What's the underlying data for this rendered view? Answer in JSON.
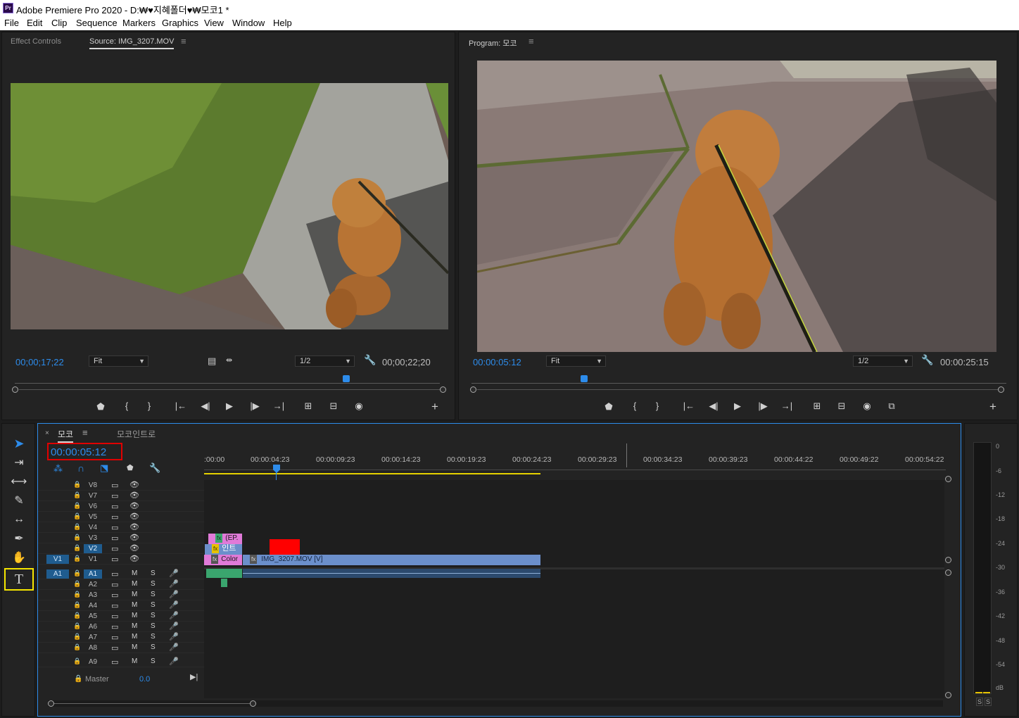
{
  "window": {
    "app_icon": "Pr",
    "title": "Adobe Premiere Pro 2020 - D:₩♥지혜폴더♥₩모코1 *"
  },
  "menu": [
    "File",
    "Edit",
    "Clip",
    "Sequence",
    "Markers",
    "Graphics",
    "View",
    "Window",
    "Help"
  ],
  "source_panel": {
    "tab_effect_controls": "Effect Controls",
    "tab_source": "Source: IMG_3207.MOV",
    "menu_icon": "≡",
    "timecode_current": "00;00;17;22",
    "zoom": "Fit",
    "resolution": "1/2",
    "timecode_duration": "00;00;22;20",
    "playhead_position": 0.78
  },
  "program_panel": {
    "tab_program": "Program: 모코",
    "menu_icon": "≡",
    "timecode_current": "00:00:05:12",
    "zoom": "Fit",
    "resolution": "1/2",
    "timecode_duration": "00:00:25:15",
    "playhead_position": 0.21
  },
  "timeline": {
    "tab_close": "×",
    "tab_active": "모코",
    "tab_menu": "≡",
    "tab_inactive": "모코인트로",
    "timecode": "00:00:05:12",
    "ruler_labels": [
      ":00:00",
      "00:00:04:23",
      "00:00:09:23",
      "00:00:14:23",
      "00:00:19:23",
      "00:00:24:23",
      "00:00:29:23",
      "00:00:34:23",
      "00:00:39:23",
      "00:00:44:22",
      "00:00:49:22",
      "00:00:54:22"
    ],
    "video_tracks": [
      "V8",
      "V7",
      "V6",
      "V5",
      "V4",
      "V3",
      "V2",
      "V1"
    ],
    "audio_tracks": [
      "A1",
      "A2",
      "A3",
      "A4",
      "A5",
      "A6",
      "A7",
      "A8",
      "A9"
    ],
    "source_patch_video": "V1",
    "source_patch_audio": "A1",
    "mute_label": "M",
    "solo_label": "S",
    "master_label": "Master",
    "master_value": "0.0",
    "clips": {
      "v3_label": "(EP.",
      "v2_label": "인트",
      "v1_color_label": "Color",
      "v1_main_label": "IMG_3207.MOV [V]",
      "fx_label": "fx"
    },
    "colors": {
      "clip_pink": "#e07ad8",
      "clip_blue": "#6b8fcb",
      "clip_audio": "#3aa56e",
      "red_box": "#ff0000",
      "work_area": "#e6d200",
      "accent": "#2d8ceb"
    }
  },
  "tools": [
    "selection-tool",
    "track-select-tool",
    "ripple-edit-tool",
    "razor-tool",
    "slip-tool",
    "pen-tool",
    "hand-tool",
    "type-tool"
  ],
  "audio_meter": {
    "labels": [
      "0",
      "-6",
      "-12",
      "-18",
      "-24",
      "-30",
      "-36",
      "-42",
      "-48",
      "-54",
      "dB"
    ],
    "solo_buttons": [
      "S",
      "S"
    ]
  }
}
